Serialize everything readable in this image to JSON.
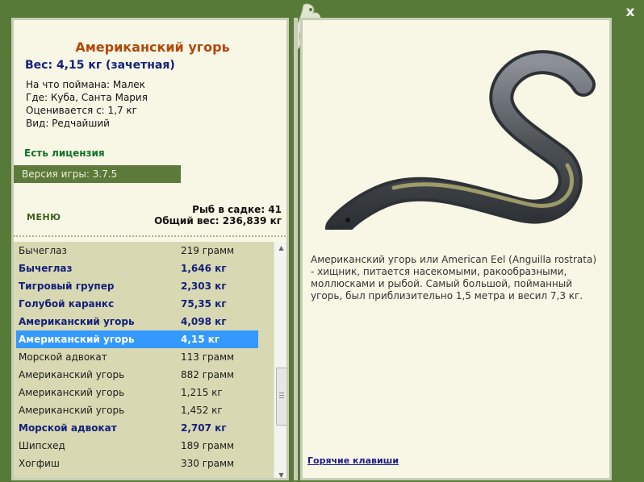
{
  "window": {
    "close_label": "x"
  },
  "fish": {
    "title": "Американский угорь",
    "weight": "Вес: 4,15 кг (зачетная)",
    "bait": "На что поймана: Малек",
    "location": "Где: Куба, Санта Мария",
    "rated_from": "Оценивается с: 1,7 кг",
    "kind": "Вид: Редчайший"
  },
  "license": "Есть лицензия",
  "version": "Версия игры: 3.7.5",
  "menu_label": "МЕНЮ",
  "stats": {
    "fish_count": "Рыб в садке: 41",
    "total_weight": "Общий вес: 236,839 кг"
  },
  "catch_list": [
    {
      "name": "Бычеглаз",
      "weight": "219 грамм"
    },
    {
      "name": "Бычеглаз",
      "weight": "1,646 кг"
    },
    {
      "name": "Тигровый групер",
      "weight": "2,303 кг"
    },
    {
      "name": "Голубой каранкс",
      "weight": "75,35 кг"
    },
    {
      "name": "Американский угорь",
      "weight": "4,098 кг"
    },
    {
      "name": "Американский угорь",
      "weight": "4,15 кг"
    },
    {
      "name": "Морской адвокат",
      "weight": "113 грамм"
    },
    {
      "name": "Американский угорь",
      "weight": "882 грамм"
    },
    {
      "name": "Американский угорь",
      "weight": "1,215 кг"
    },
    {
      "name": "Американский угорь",
      "weight": "1,452 кг"
    },
    {
      "name": "Морской адвокат",
      "weight": "2,707 кг"
    },
    {
      "name": "Шипсхед",
      "weight": "189 грамм"
    },
    {
      "name": "Хогфиш",
      "weight": "330 грамм"
    }
  ],
  "description": "Американский угорь или American Eel (Anguilla rostrata) - хищник, питается насекомыми, ракообразными, моллюсками и рыбой. Самый большой, пойманный угорь, был приблизительно 1,5 метра и весил 7,3 кг.",
  "hotkeys_label": "Горячие клавиши",
  "colors": {
    "frame": "#587a39",
    "panel": "#f8f7e6",
    "title": "#b3470a",
    "weight": "#142179",
    "license": "#107226",
    "selection": "#3399ff",
    "list_bg": "#d8d8b3"
  }
}
